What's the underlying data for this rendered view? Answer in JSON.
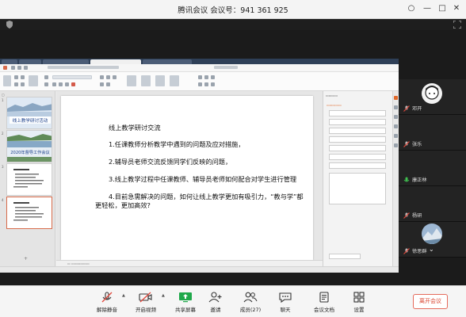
{
  "window": {
    "title": "腾讯会议 会议号：941 361 925"
  },
  "slide": {
    "lines": [
      "线上教学研讨交流",
      "1.任课教师分析教学中遇到的问题及应对措施，",
      "2.辅导员老师交流反馈同学们反映的问题，",
      "3.线上教学过程中任课教师、辅导员老师如何配合对学生进行管理",
      "4.目前急需解决的问题，如何让线上教学更加有吸引力，“教与学”都",
      "更轻松，更加高效?"
    ]
  },
  "thumbnails": [
    {
      "num": "1",
      "title": "线上教学研讨活动"
    },
    {
      "num": "2",
      "title": "2020年督导工作会议"
    },
    {
      "num": "3",
      "title": ""
    },
    {
      "num": "4",
      "title": ""
    }
  ],
  "participants": [
    {
      "name": "邓开",
      "mic": "muted"
    },
    {
      "name": "张乐",
      "mic": "muted"
    },
    {
      "name": "康正林",
      "mic": "active"
    },
    {
      "name": "杨研",
      "mic": "muted"
    },
    {
      "name": "徐思群",
      "mic": "muted"
    }
  ],
  "toolbar": {
    "mute_label": "解除静音",
    "video_label": "开启视频",
    "share_label": "共享屏幕",
    "invite_label": "邀请",
    "members_label": "成员(27)",
    "chat_label": "聊天",
    "docs_label": "会议文档",
    "settings_label": "设置",
    "leave_label": "离开会议"
  },
  "colors": {
    "leave_accent": "#e56a5b",
    "mic_muted": "#e0463a",
    "mic_active": "#3fbf4f",
    "share_icon": "#1fa84a"
  }
}
